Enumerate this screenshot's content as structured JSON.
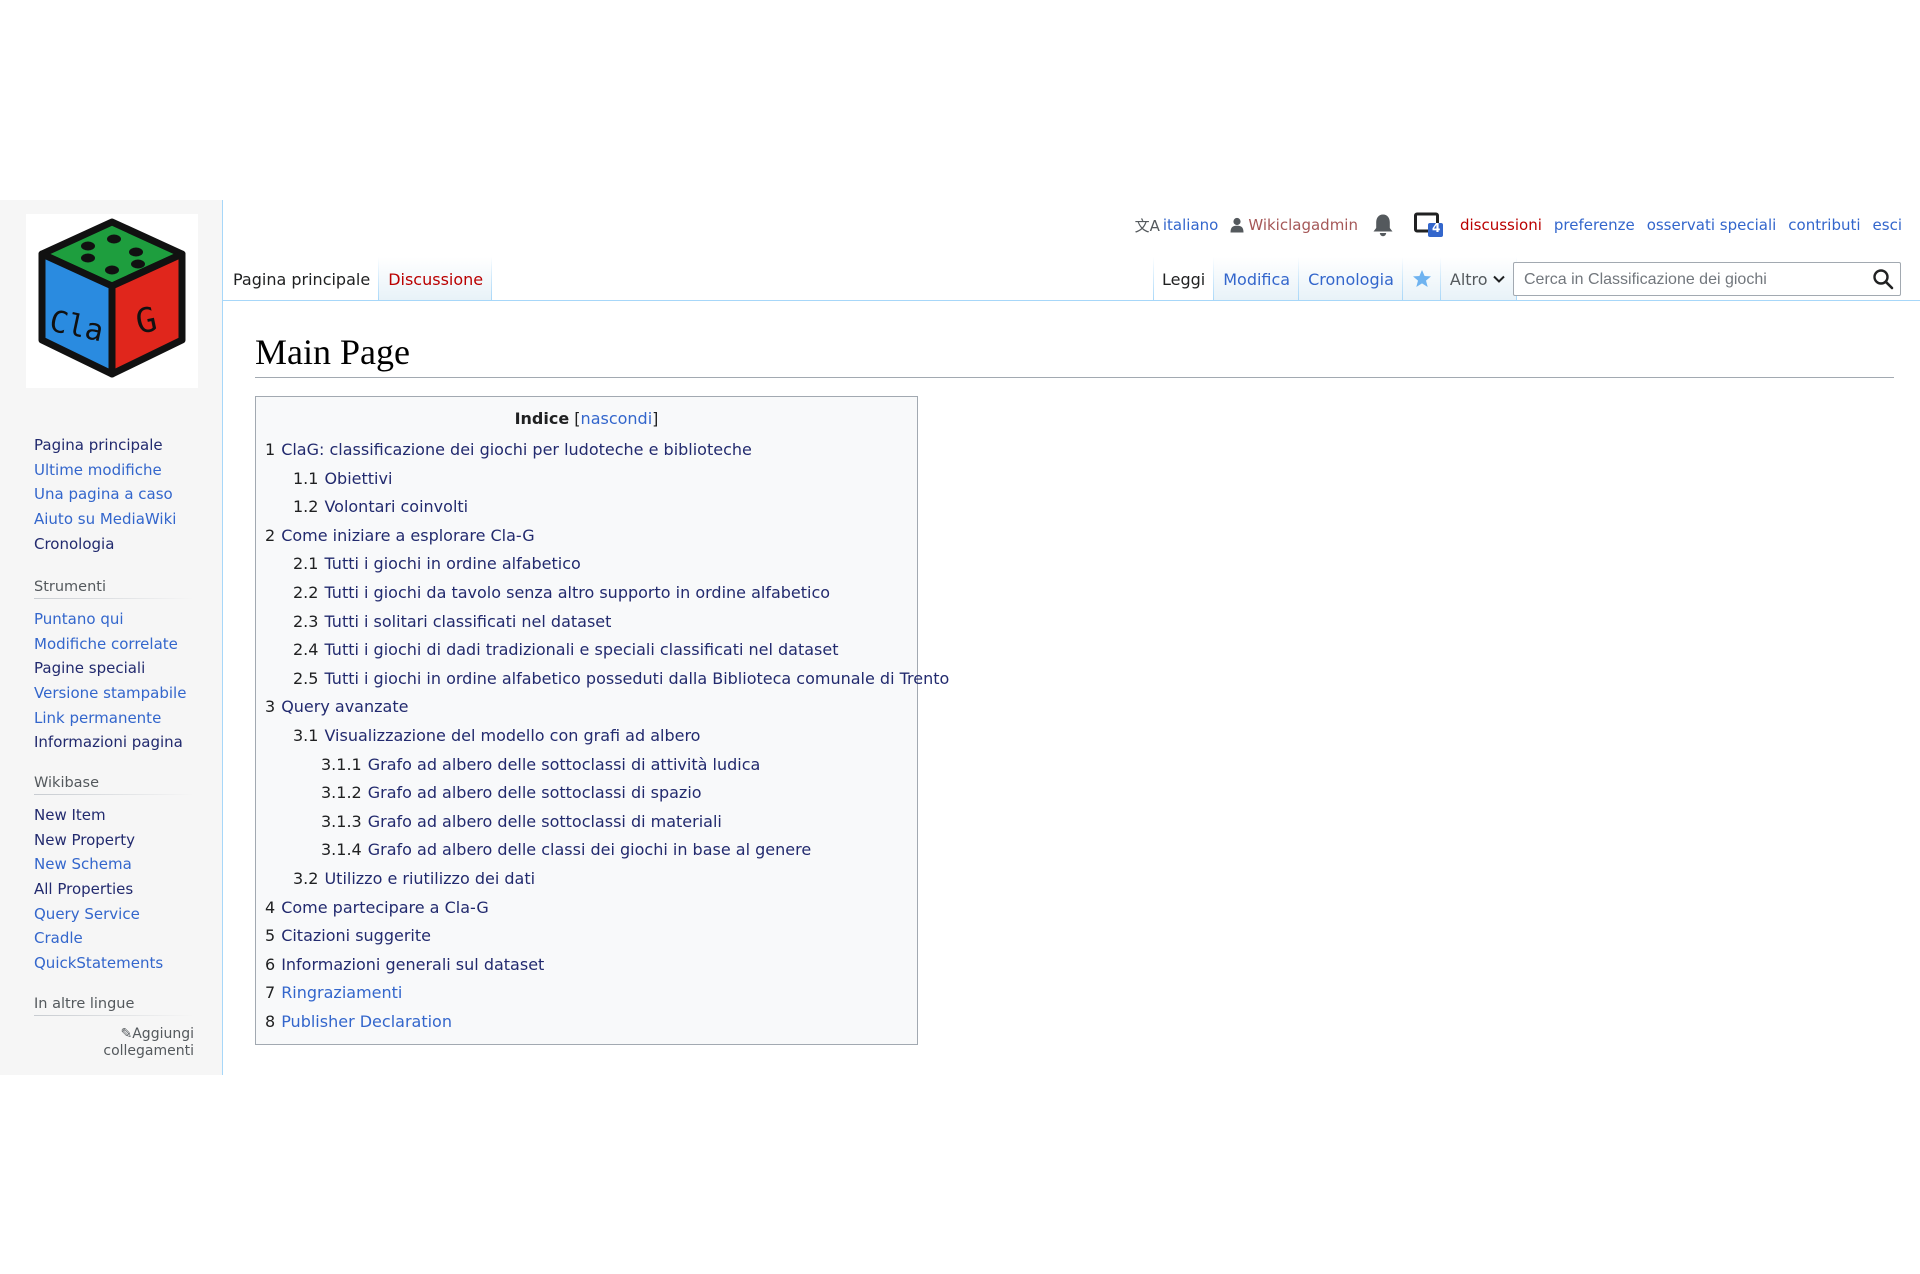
{
  "personal_tools": {
    "language": "italiano",
    "username": "Wikiclagadmin",
    "notification_count": "4",
    "talk": "discussioni",
    "preferences": "preferenze",
    "watchlist": "osservati speciali",
    "contributions": "contributi",
    "logout": "esci"
  },
  "namespace_tabs": {
    "page": "Pagina principale",
    "talk": "Discussione"
  },
  "view_tabs": {
    "read": "Leggi",
    "edit": "Modifica",
    "history": "Cronologia",
    "more": "Altro"
  },
  "search": {
    "placeholder": "Cerca in Classificazione dei giochi"
  },
  "logo": {
    "text_left": "Cla",
    "text_right": "G"
  },
  "sidebar": {
    "navigation": [
      "Pagina principale",
      "Ultime modifiche",
      "Una pagina a caso",
      "Aiuto su MediaWiki",
      "Cronologia"
    ],
    "tools_heading": "Strumenti",
    "tools": [
      "Puntano qui",
      "Modifiche correlate",
      "Pagine speciali",
      "Versione stampabile",
      "Link permanente",
      "Informazioni pagina"
    ],
    "wikibase_heading": "Wikibase",
    "wikibase": [
      "New Item",
      "New Property",
      "New Schema",
      "All Properties",
      "Query Service",
      "Cradle",
      "QuickStatements"
    ],
    "languages_heading": "In altre lingue",
    "add_links_line1": "Aggiungi",
    "add_links_line2": "collegamenti"
  },
  "page": {
    "title": "Main Page"
  },
  "toc": {
    "title": "Indice",
    "hide_label": "nascondi",
    "items": [
      {
        "number": "1",
        "text": "ClaG: classificazione dei giochi per ludoteche e biblioteche",
        "level": 1
      },
      {
        "number": "1.1",
        "text": "Obiettivi",
        "level": 2
      },
      {
        "number": "1.2",
        "text": "Volontari coinvolti",
        "level": 2
      },
      {
        "number": "2",
        "text": "Come iniziare a esplorare Cla-G",
        "level": 1
      },
      {
        "number": "2.1",
        "text": "Tutti i giochi in ordine alfabetico",
        "level": 2
      },
      {
        "number": "2.2",
        "text": "Tutti i giochi da tavolo senza altro supporto in ordine alfabetico",
        "level": 2
      },
      {
        "number": "2.3",
        "text": "Tutti i solitari classificati nel dataset",
        "level": 2
      },
      {
        "number": "2.4",
        "text": "Tutti i giochi di dadi tradizionali e speciali classificati nel dataset",
        "level": 2
      },
      {
        "number": "2.5",
        "text": "Tutti i giochi in ordine alfabetico posseduti dalla Biblioteca comunale di Trento",
        "level": 2
      },
      {
        "number": "3",
        "text": "Query avanzate",
        "level": 1
      },
      {
        "number": "3.1",
        "text": "Visualizzazione del modello con grafi ad albero",
        "level": 2
      },
      {
        "number": "3.1.1",
        "text": "Grafo ad albero delle sottoclassi di attività ludica",
        "level": 3
      },
      {
        "number": "3.1.2",
        "text": "Grafo ad albero delle sottoclassi di spazio",
        "level": 3
      },
      {
        "number": "3.1.3",
        "text": "Grafo ad albero delle sottoclassi di materiali",
        "level": 3
      },
      {
        "number": "3.1.4",
        "text": "Grafo ad albero delle classi dei giochi in base al genere",
        "level": 3
      },
      {
        "number": "3.2",
        "text": "Utilizzo e riutilizzo dei dati",
        "level": 2
      },
      {
        "number": "4",
        "text": "Come partecipare a Cla-G",
        "level": 1
      },
      {
        "number": "5",
        "text": "Citazioni suggerite",
        "level": 1
      },
      {
        "number": "6",
        "text": "Informazioni generali sul dataset",
        "level": 1
      },
      {
        "number": "7",
        "text": "Ringraziamenti",
        "level": 1
      },
      {
        "number": "8",
        "text": "Publisher Declaration",
        "level": 1
      }
    ]
  },
  "colors": {
    "link": "#3366cc",
    "visited": "#222a6e",
    "new_link": "#ba0000",
    "die_green": "#1e9e3e",
    "die_blue": "#2a8be0",
    "die_red": "#e0261c"
  }
}
